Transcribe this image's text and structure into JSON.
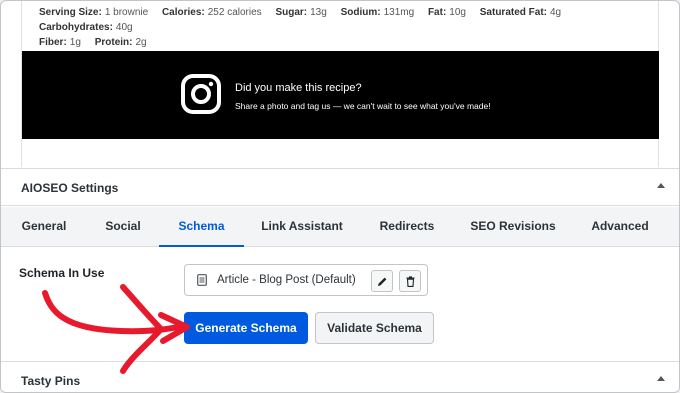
{
  "recipe": {
    "nutrition": [
      {
        "label": "Serving Size:",
        "value": "1 brownie"
      },
      {
        "label": "Calories:",
        "value": "252 calories"
      },
      {
        "label": "Sugar:",
        "value": "13g"
      },
      {
        "label": "Sodium:",
        "value": "131mg"
      },
      {
        "label": "Fat:",
        "value": "10g"
      },
      {
        "label": "Saturated Fat:",
        "value": "4g"
      },
      {
        "label": "Carbohydrates:",
        "value": "40g"
      },
      {
        "label": "Fiber:",
        "value": "1g"
      },
      {
        "label": "Protein:",
        "value": "2g"
      }
    ],
    "instagram": {
      "title": "Did you make this recipe?",
      "subtitle": "Share a photo and tag us — we can't wait to see what you've made!",
      "icon": "instagram-icon"
    }
  },
  "aioseo": {
    "title": "AIOSEO Settings",
    "tabs": [
      "General",
      "Social",
      "Schema",
      "Link Assistant",
      "Redirects",
      "SEO Revisions",
      "Advanced"
    ],
    "active_tab": "Schema",
    "schema_label": "Schema In Use",
    "schema_value": "Article - Blog Post (Default)",
    "generate_label": "Generate Schema",
    "validate_label": "Validate Schema",
    "colors": {
      "accent": "#005ae0",
      "annotation_arrow": "#e8192c"
    }
  },
  "tasty": {
    "title": "Tasty Pins"
  }
}
